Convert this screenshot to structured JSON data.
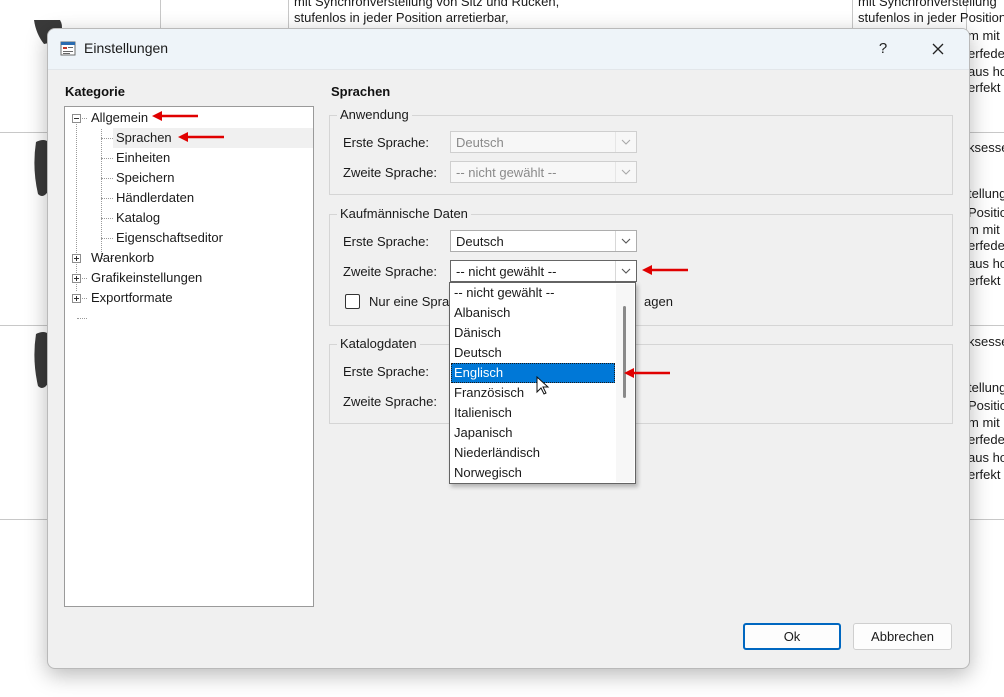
{
  "background": {
    "top_text_1": "mit Synchronverstellung von Sitz und Rücken,",
    "top_text_2": "stufenlos in jeder Position arretierbar,",
    "right_text_1": "mit Synchronverstellung",
    "right_text_2": "stufenlos in jeder Position",
    "right_lines_a": [
      "m mit",
      "erfede",
      "aus ho",
      "erfekt"
    ],
    "right_lines_b": [
      "ksesse",
      "tellung",
      "Positio",
      "m mit",
      "erfede",
      "aus ho",
      "erfekt"
    ],
    "right_lines_c": [
      "ksesse",
      "tellung",
      "Positio",
      "m mit",
      "erfede",
      "aus ho",
      "erfekt"
    ]
  },
  "dialog": {
    "title": "Einstellungen",
    "help_label": "?",
    "close_icon": "close-icon",
    "category_heading": "Kategorie",
    "section_heading": "Sprachen"
  },
  "tree": {
    "items": [
      {
        "label": "Allgemein",
        "expanded": true
      },
      {
        "label": "Sprachen",
        "selected": true
      },
      {
        "label": "Einheiten"
      },
      {
        "label": "Speichern"
      },
      {
        "label": "Händlerdaten"
      },
      {
        "label": "Katalog"
      },
      {
        "label": "Eigenschaftseditor"
      },
      {
        "label": "Warenkorb",
        "expanded": false
      },
      {
        "label": "Grafikeinstellungen",
        "expanded": false
      },
      {
        "label": "Exportformate",
        "expanded": false
      }
    ]
  },
  "groups": {
    "anwendung": {
      "title": "Anwendung",
      "first_label": "Erste Sprache:",
      "first_value": "Deutsch",
      "second_label": "Zweite Sprache:",
      "second_value": "-- nicht gewählt --"
    },
    "kaufmaennisch": {
      "title": "Kaufmännische Daten",
      "first_label": "Erste Sprache:",
      "first_value": "Deutsch",
      "second_label": "Zweite Sprache:",
      "second_value": "-- nicht gewählt --",
      "checkbox_label_start": "Nur eine Spra",
      "checkbox_label_end": "agen"
    },
    "katalog": {
      "title": "Katalogdaten",
      "first_label": "Erste Sprache:",
      "second_label": "Zweite Sprache:"
    }
  },
  "dropdown": {
    "options": [
      "-- nicht gewählt --",
      "Albanisch",
      "Dänisch",
      "Deutsch",
      "Englisch",
      "Französisch",
      "Italienisch",
      "Japanisch",
      "Niederländisch",
      "Norwegisch"
    ],
    "highlighted": "Englisch"
  },
  "buttons": {
    "ok": "Ok",
    "cancel": "Abbrechen"
  },
  "colors": {
    "accent": "#0078d7",
    "annotation_arrow": "#e00000"
  }
}
